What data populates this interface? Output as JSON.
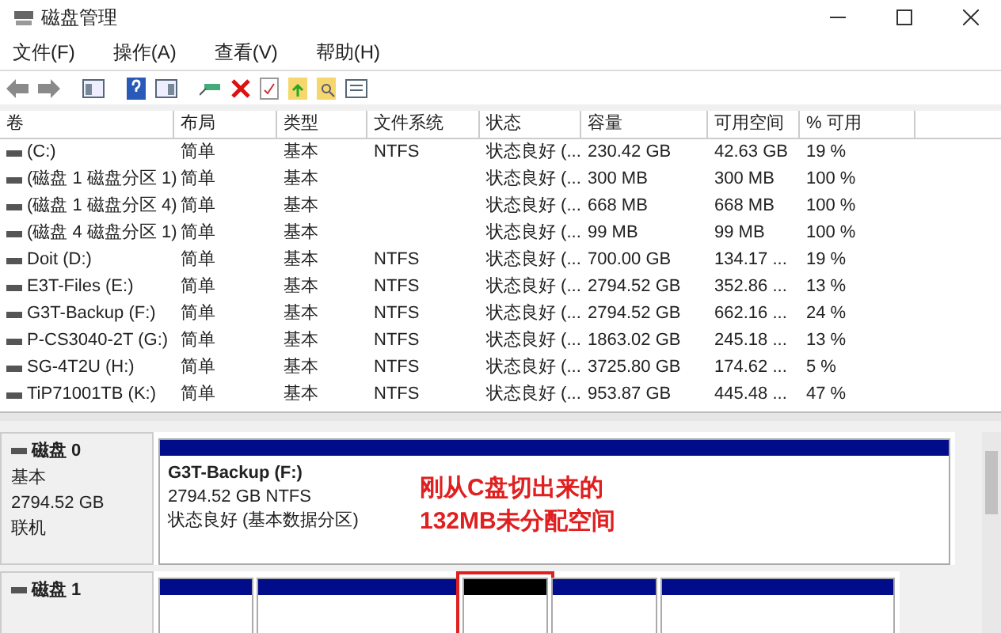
{
  "window": {
    "title": "磁盘管理"
  },
  "menu": [
    "文件(F)",
    "操作(A)",
    "查看(V)",
    "帮助(H)"
  ],
  "table": {
    "columns": [
      "卷",
      "布局",
      "类型",
      "文件系统",
      "状态",
      "容量",
      "可用空间",
      "% 可用"
    ],
    "rows": [
      [
        "(C:)",
        "简单",
        "基本",
        "NTFS",
        "状态良好 (...",
        "230.42 GB",
        "42.63 GB",
        "19 %"
      ],
      [
        "(磁盘 1 磁盘分区 1)",
        "简单",
        "基本",
        "",
        "状态良好 (...",
        "300 MB",
        "300 MB",
        "100 %"
      ],
      [
        "(磁盘 1 磁盘分区 4)",
        "简单",
        "基本",
        "",
        "状态良好 (...",
        "668 MB",
        "668 MB",
        "100 %"
      ],
      [
        "(磁盘 4 磁盘分区 1)",
        "简单",
        "基本",
        "",
        "状态良好 (...",
        "99 MB",
        "99 MB",
        "100 %"
      ],
      [
        "Doit (D:)",
        "简单",
        "基本",
        "NTFS",
        "状态良好 (...",
        "700.00 GB",
        "134.17 ...",
        "19 %"
      ],
      [
        "E3T-Files (E:)",
        "简单",
        "基本",
        "NTFS",
        "状态良好 (...",
        "2794.52 GB",
        "352.86 ...",
        "13 %"
      ],
      [
        "G3T-Backup (F:)",
        "简单",
        "基本",
        "NTFS",
        "状态良好 (...",
        "2794.52 GB",
        "662.16 ...",
        "24 %"
      ],
      [
        "P-CS3040-2T (G:)",
        "简单",
        "基本",
        "NTFS",
        "状态良好 (...",
        "1863.02 GB",
        "245.18 ...",
        "13 %"
      ],
      [
        "SG-4T2U (H:)",
        "简单",
        "基本",
        "NTFS",
        "状态良好 (...",
        "3725.80 GB",
        "174.62 ...",
        "5 %"
      ],
      [
        "TiP71001TB (K:)",
        "简单",
        "基本",
        "NTFS",
        "状态良好 (...",
        "953.87 GB",
        "445.48 ...",
        "47 %"
      ]
    ]
  },
  "disks": [
    {
      "name": "磁盘 0",
      "info": [
        "基本",
        "2794.52 GB",
        "联机"
      ],
      "partitions": [
        {
          "kind": "primary",
          "lines": [
            "G3T-Backup  (F:)",
            "2794.52 GB NTFS",
            "状态良好 (基本数据分区)"
          ]
        }
      ]
    },
    {
      "name": "磁盘 1",
      "partitions": [
        {
          "kind": "primary"
        },
        {
          "kind": "primary"
        },
        {
          "kind": "unallocated"
        },
        {
          "kind": "primary"
        },
        {
          "kind": "primary"
        }
      ]
    }
  ],
  "annotation": {
    "lines": [
      "刚从C盘切出来的",
      "132MB未分配空间"
    ]
  }
}
